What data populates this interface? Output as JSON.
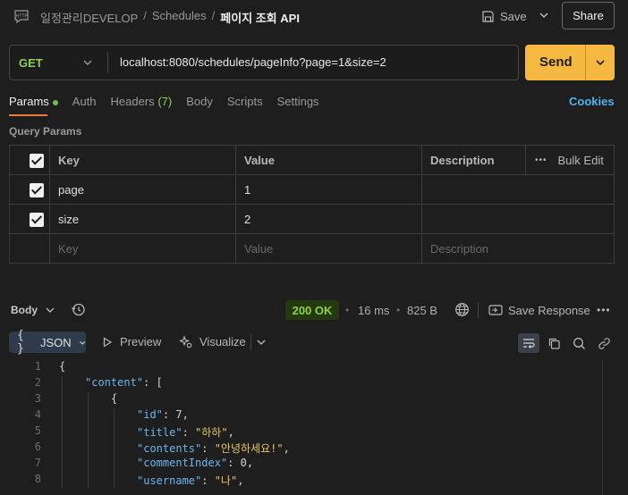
{
  "breadcrumb": {
    "parts": [
      "일정관리DEVELOP",
      "Schedules"
    ],
    "current": "페이지 조회 API"
  },
  "header": {
    "save_label": "Save",
    "share_label": "Share"
  },
  "request": {
    "method": "GET",
    "url": "localhost:8080/schedules/pageInfo?page=1&size=2",
    "send_label": "Send"
  },
  "tabs": {
    "params": "Params",
    "auth": "Auth",
    "headers": "Headers",
    "headers_count": "(7)",
    "body": "Body",
    "scripts": "Scripts",
    "settings": "Settings",
    "cookies": "Cookies"
  },
  "query_params": {
    "title": "Query Params",
    "columns": [
      "Key",
      "Value",
      "Description"
    ],
    "bulk_edit": "Bulk Edit",
    "rows": [
      {
        "key": "page",
        "value": "1",
        "description": ""
      },
      {
        "key": "size",
        "value": "2",
        "description": ""
      }
    ],
    "placeholders": {
      "key": "Key",
      "value": "Value",
      "description": "Description"
    }
  },
  "response": {
    "body_label": "Body",
    "status": "200 OK",
    "time": "16 ms",
    "size": "825 B",
    "save_response": "Save Response",
    "format": "JSON",
    "preview": "Preview",
    "visualize": "Visualize"
  },
  "code_lines": [
    {
      "n": "1",
      "indent": 0,
      "parts": [
        [
          "p",
          "{"
        ]
      ]
    },
    {
      "n": "2",
      "indent": 1,
      "parts": [
        [
          "k",
          "\"content\""
        ],
        [
          "p",
          ": ["
        ]
      ]
    },
    {
      "n": "3",
      "indent": 2,
      "parts": [
        [
          "p",
          "{"
        ]
      ]
    },
    {
      "n": "4",
      "indent": 3,
      "parts": [
        [
          "k",
          "\"id\""
        ],
        [
          "p",
          ": "
        ],
        [
          "n",
          "7"
        ],
        [
          "p",
          ","
        ]
      ]
    },
    {
      "n": "5",
      "indent": 3,
      "parts": [
        [
          "k",
          "\"title\""
        ],
        [
          "p",
          ": "
        ],
        [
          "s",
          "\"하하\""
        ],
        [
          "p",
          ","
        ]
      ]
    },
    {
      "n": "6",
      "indent": 3,
      "parts": [
        [
          "k",
          "\"contents\""
        ],
        [
          "p",
          ": "
        ],
        [
          "s",
          "\"안녕하세요!\""
        ],
        [
          "p",
          ","
        ]
      ]
    },
    {
      "n": "7",
      "indent": 3,
      "parts": [
        [
          "k",
          "\"commentIndex\""
        ],
        [
          "p",
          ": "
        ],
        [
          "n",
          "0"
        ],
        [
          "p",
          ","
        ]
      ]
    },
    {
      "n": "8",
      "indent": 3,
      "parts": [
        [
          "k",
          "\"username\""
        ],
        [
          "p",
          ": "
        ],
        [
          "s",
          "\"나\""
        ],
        [
          "p",
          ","
        ]
      ]
    }
  ],
  "colors": {
    "accent": "#f5b942",
    "status_ok": "#8fd14f",
    "link": "#4fb3f0",
    "tab_underline": "#f07a3a"
  }
}
